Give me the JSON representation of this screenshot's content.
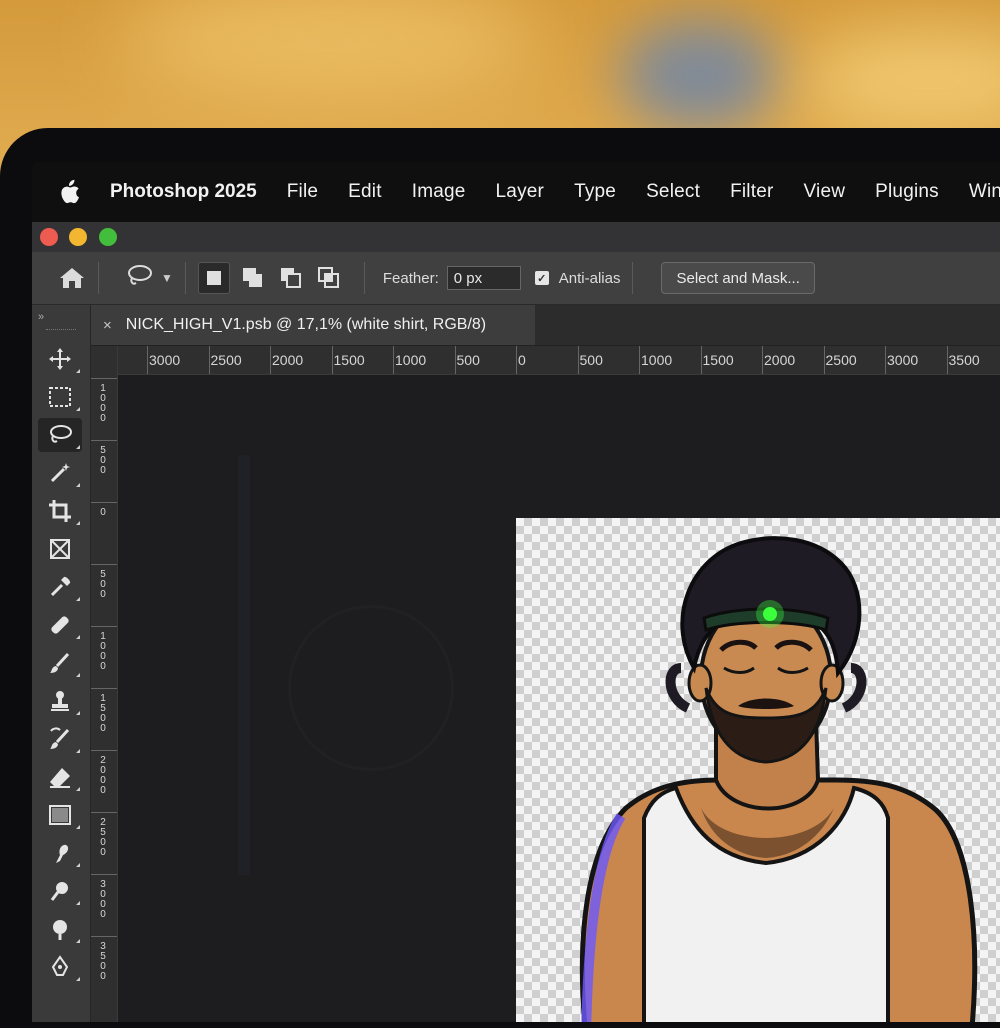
{
  "menubar": {
    "app_name": "Photoshop 2025",
    "items": [
      "File",
      "Edit",
      "Image",
      "Layer",
      "Type",
      "Select",
      "Filter",
      "View",
      "Plugins",
      "Win"
    ]
  },
  "options_bar": {
    "feather_label": "Feather:",
    "feather_value": "0 px",
    "antialias_label": "Anti-alias",
    "antialias_checked": true,
    "select_mask_label": "Select and Mask..."
  },
  "toolbox": {
    "collapse_label": "»",
    "tools": [
      "move",
      "marquee",
      "lasso",
      "magic-wand",
      "crop",
      "frame",
      "eyedropper",
      "healing-brush",
      "brush",
      "clone-stamp",
      "history-brush",
      "eraser",
      "gradient",
      "smudge",
      "dodge",
      "burn",
      "pen"
    ]
  },
  "document": {
    "tab_title": "NICK_HIGH_V1.psb @ 17,1% (white shirt, RGB/8)",
    "close_symbol": "×"
  },
  "rulers": {
    "horizontal": [
      "3000",
      "2500",
      "2000",
      "1500",
      "1000",
      "500",
      "0",
      "500",
      "1000",
      "1500",
      "2000",
      "2500",
      "3000",
      "3500"
    ],
    "vertical": [
      "1000",
      "500",
      "0",
      "500",
      "1000",
      "1500",
      "2000",
      "2500",
      "3000",
      "3500"
    ]
  },
  "colors": {
    "ps_panel": "#3c3c3c",
    "ps_canvas": "#1d1d1f",
    "menubar": "#0f0f10",
    "headband_led": "#3cff3c"
  }
}
